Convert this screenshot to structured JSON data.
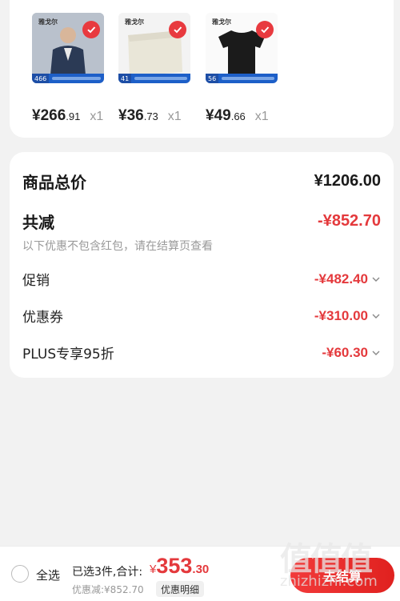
{
  "products": [
    {
      "logo": "雅戈尔",
      "promo_count": "466",
      "price_main": "¥266",
      "price_dec": ".91",
      "qty": "x1"
    },
    {
      "logo": "雅戈尔",
      "promo_count": "41",
      "price_main": "¥36",
      "price_dec": ".73",
      "qty": "x1"
    },
    {
      "logo": "雅戈尔",
      "promo_count": "56",
      "price_main": "¥49",
      "price_dec": ".66",
      "qty": "x1"
    }
  ],
  "summary": {
    "total_label": "商品总价",
    "total_value": "¥1206.00",
    "reduce_label": "共减",
    "reduce_value": "-¥852.70",
    "note": "以下优惠不包含红包，请在结算页查看",
    "items": [
      {
        "label": "促销",
        "value": "-¥482.40"
      },
      {
        "label": "优惠券",
        "value": "-¥310.00"
      },
      {
        "label": "PLUS专享95折",
        "value": "-¥60.30"
      }
    ]
  },
  "bottom": {
    "select_all": "全选",
    "selected_summary": "已选3件,合计:",
    "total_currency": "¥",
    "total_int": "353",
    "total_dec": ".30",
    "discount_line": "优惠减:¥852.70",
    "detail_button": "优惠明细",
    "checkout_button": "去结算"
  },
  "watermark": {
    "chars": "值值值",
    "site": "zhizhizhi.com"
  },
  "colors": {
    "accent_red": "#e4393c",
    "badge_red": "#e83a3f",
    "promo_blue": "#1d5fc8"
  }
}
